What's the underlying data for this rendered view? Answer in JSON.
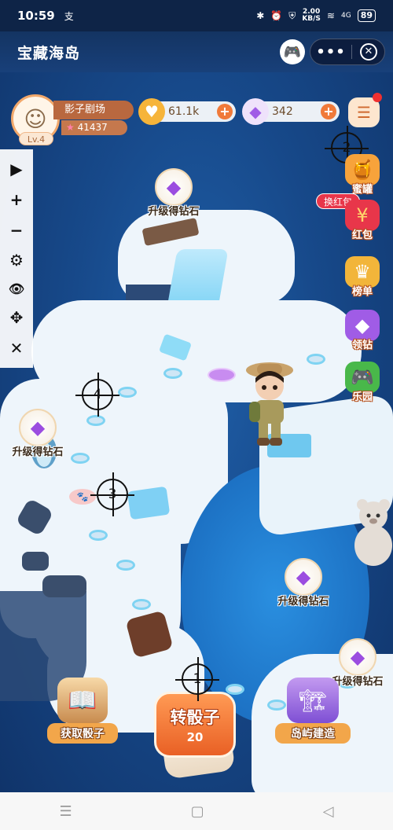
{
  "status_bar": {
    "time": "10:59",
    "notification_glyph": "支",
    "network_speed": "2.00",
    "network_unit": "KB/S",
    "signal_label": "4G",
    "battery": "89"
  },
  "app": {
    "title": "宝藏海岛"
  },
  "player": {
    "name": "影子剧场",
    "level": "Lv.4",
    "score": "41437"
  },
  "resources": {
    "hearts": "61.1k",
    "diamonds": "342"
  },
  "toolbar": {
    "play": "▶",
    "zoom_in": "+",
    "zoom_out": "−",
    "settings": "⚙",
    "hide": "👁",
    "move": "✥",
    "close": "✕"
  },
  "side_menu": [
    {
      "label": "蜜罐",
      "icon": "honey-jar-icon",
      "color": "#f7a33b"
    },
    {
      "label": "红包",
      "icon": "red-envelope-icon",
      "color": "#e8364a"
    },
    {
      "label": "榜单",
      "icon": "crown-icon",
      "color": "#f2b53a"
    },
    {
      "label": "领钻",
      "icon": "diamond-icon",
      "color": "#a05ce6"
    },
    {
      "label": "乐园",
      "icon": "gamepad-icon",
      "color": "#49b84a"
    }
  ],
  "hongbao_tag": "换红包",
  "gem_bubbles": [
    {
      "label": "升级得钻石"
    },
    {
      "label": "升级得钻石"
    },
    {
      "label": "升级得钻石"
    },
    {
      "label": "升级得钻石"
    }
  ],
  "markers": [
    "1",
    "2",
    "3",
    "4"
  ],
  "bottom": {
    "get_dice": "获取骰子",
    "roll_dice": "转骰子",
    "dice_count": "20",
    "island_build": "岛屿建造"
  },
  "colors": {
    "accent_orange": "#e96025",
    "ocean": "#17498a",
    "ice": "#eef5fb"
  }
}
